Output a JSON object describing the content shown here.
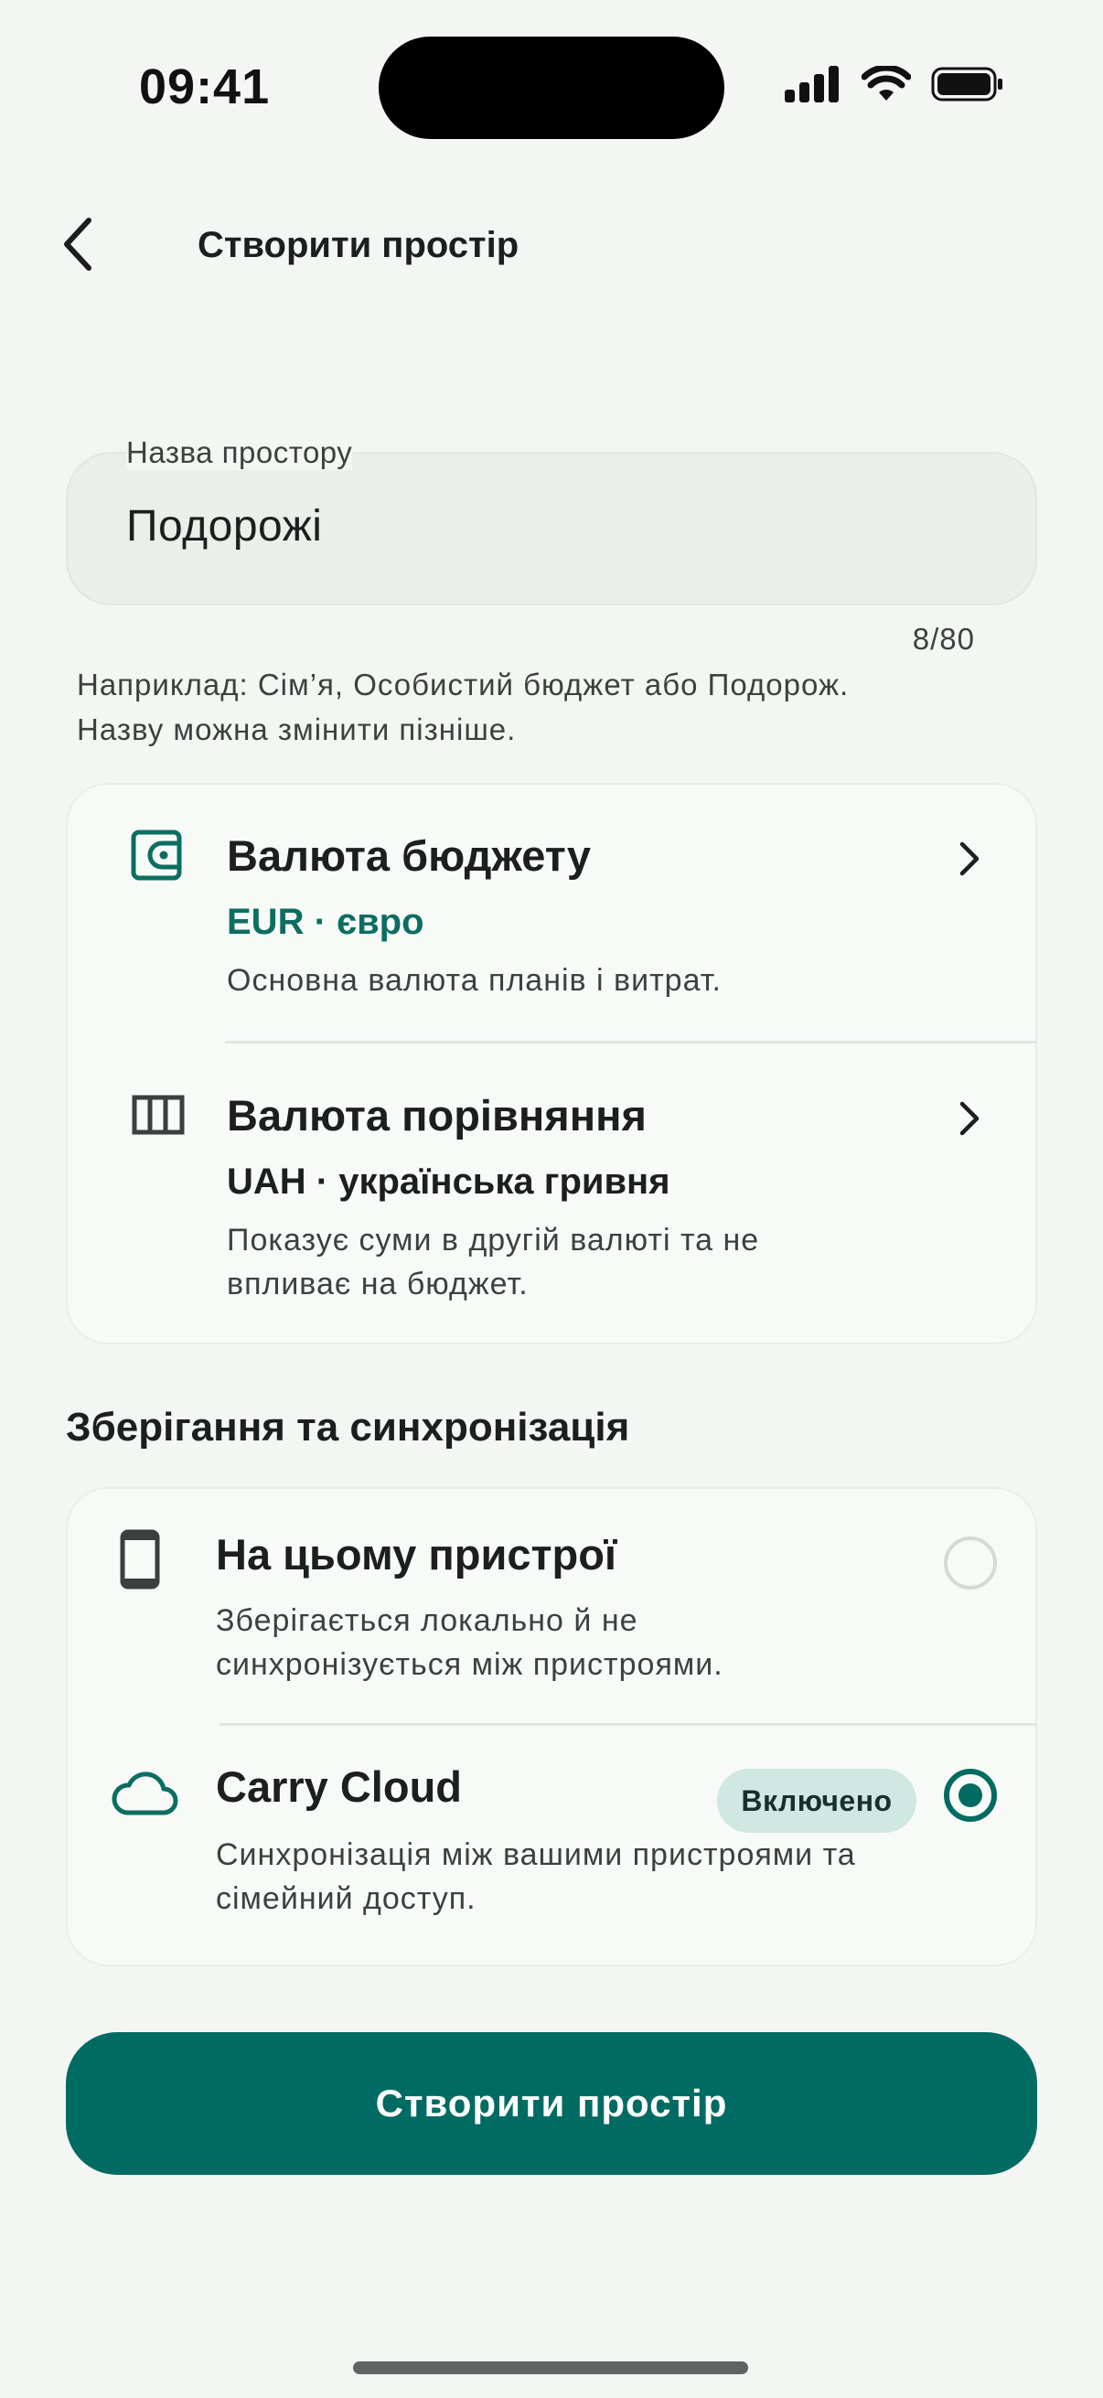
{
  "status_bar": {
    "time": "09:41"
  },
  "header": {
    "title": "Створити простір",
    "back_icon": "chevron-left-icon"
  },
  "name_field": {
    "label": "Назва простору",
    "value": "Подорожі",
    "counter": "8/80",
    "hint_line1": "Наприклад: Сім’я, Особистий бюджет або Подорож.",
    "hint_line2": "Назву можна змінити пізніше."
  },
  "currency": {
    "budget": {
      "title": "Валюта бюджету",
      "value": "EUR · євро",
      "desc": "Основна валюта планів і витрат.",
      "icon": "wallet-icon"
    },
    "comparison": {
      "title": "Валюта порівняння",
      "value": "UAH · українська гривня",
      "desc_line1": "Показує суми в другій валюті та не",
      "desc_line2": "впливає на бюджет.",
      "icon": "columns-icon"
    }
  },
  "storage": {
    "section_title": "Зберігання та синхронізація",
    "local": {
      "title": "На цьому пристрої",
      "desc_line1": "Зберігається локально й не",
      "desc_line2": "синхронізується між пристроями.",
      "selected": false,
      "icon": "phone-icon"
    },
    "cloud": {
      "title": "Carry Cloud",
      "badge": "Включено",
      "desc_line1": "Синхронізація між вашими пристроями та",
      "desc_line2": "сімейний доступ.",
      "selected": true,
      "icon": "cloud-icon"
    }
  },
  "actions": {
    "create_label": "Створити простір"
  },
  "colors": {
    "accent": "#006b62",
    "accent_text": "#0b6e60",
    "badge_bg": "#cfe8e2",
    "background": "#f4f6f3"
  }
}
